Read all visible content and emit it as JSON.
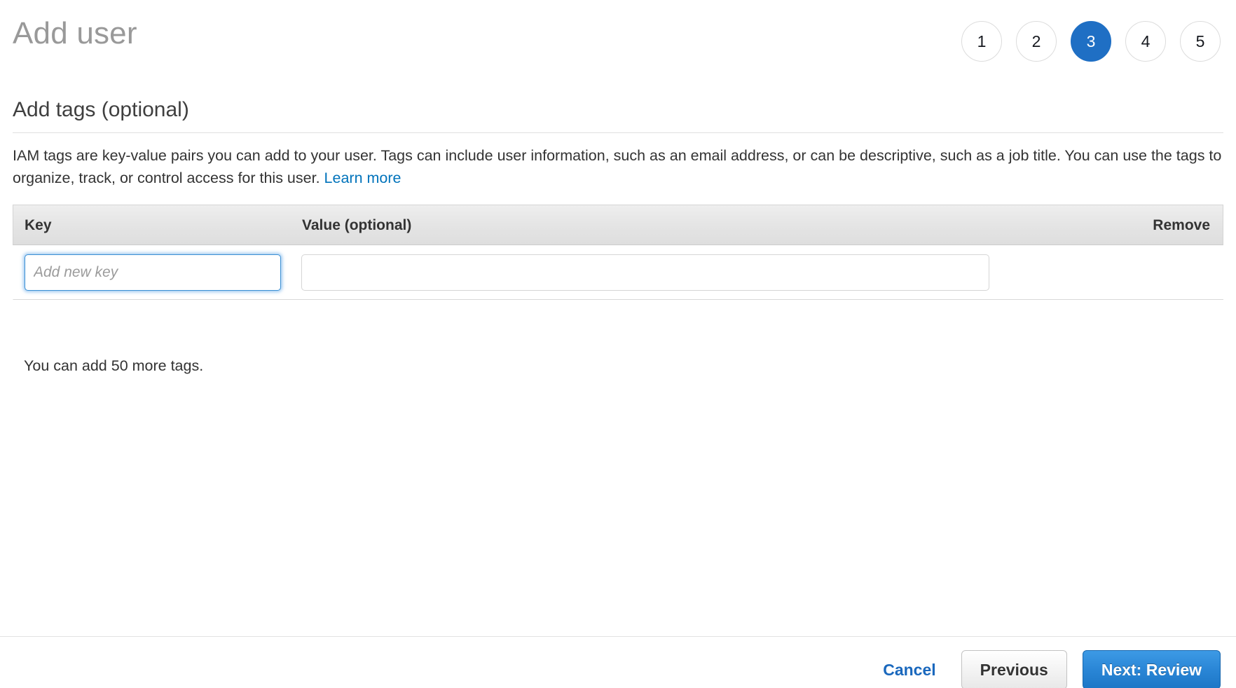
{
  "window": {
    "title": "Add user"
  },
  "wizard": {
    "steps": [
      {
        "number": "1",
        "active": false
      },
      {
        "number": "2",
        "active": false
      },
      {
        "number": "3",
        "active": true
      },
      {
        "number": "4",
        "active": false
      },
      {
        "number": "5",
        "active": false
      }
    ],
    "active_step": 3,
    "total_steps": 5,
    "active_color": "#1f6fc4"
  },
  "section": {
    "title": "Add tags (optional)",
    "description_before_link": "IAM tags are key-value pairs you can add to your user. Tags can include user information, such as an email address, or can be descriptive, such as a job title. You can use the tags to organize, track, or control access for this user. ",
    "link_label": "Learn more",
    "link_color": "#0073bb"
  },
  "tags_table": {
    "columns": {
      "key": "Key",
      "value": "Value (optional)",
      "remove": "Remove"
    },
    "rows": [
      {
        "key_value": "",
        "key_placeholder": "Add new key",
        "value_value": "",
        "value_placeholder": "",
        "key_focused": true
      }
    ],
    "note": "You can add 50 more tags.",
    "remaining_tags": 50
  },
  "footer": {
    "cancel_label": "Cancel",
    "previous_label": "Previous",
    "next_label": "Next: Review",
    "cancel_color": "#1a68bd",
    "primary_color": "#2a86d6"
  }
}
